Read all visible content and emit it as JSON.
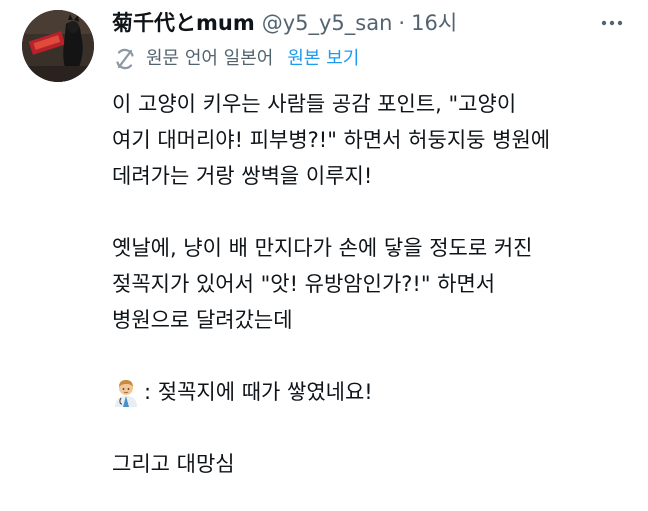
{
  "tweet": {
    "display_name": "菊千代とmum",
    "handle": "@y5_y5_san",
    "separator": "·",
    "time": "16시",
    "translation_note": "원문 언어 일본어",
    "show_original": "원본 보기",
    "paragraphs": [
      [
        "이 고양이 키우는 사람들 공감 포인트, \"고양이",
        "여기 대머리야! 피부병?!\" 하면서 허둥지둥 병원에",
        "데려가는 거랑 쌍벽을 이루지!"
      ],
      [
        "옛날에, 냥이 배 만지다가 손에 닿을 정도로 커진",
        "젖꼭지가 있어서 \"앗! 유방암인가?!\" 하면서",
        "병원으로 달려갔는데"
      ],
      [
        ": 젖꼭지에 때가 쌓였네요!"
      ],
      [
        "그리고 대망심"
      ]
    ],
    "icons": {
      "more": "more-dots-icon",
      "translate": "translate-icon",
      "emoji": "doctor-emoji-icon"
    },
    "colors": {
      "link": "#1d9bf0",
      "secondary": "#536471",
      "text": "#0f1419"
    }
  }
}
